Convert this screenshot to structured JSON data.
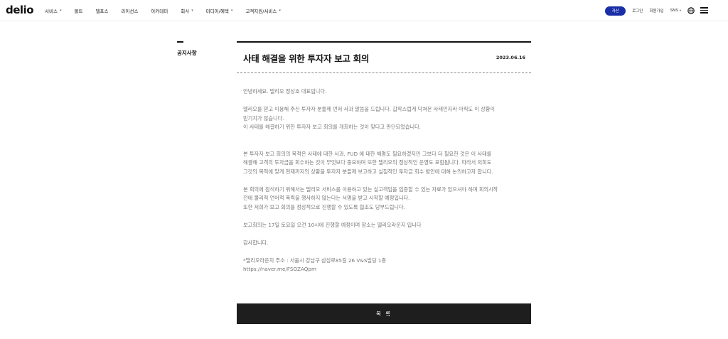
{
  "header": {
    "logo": "delio",
    "nav": [
      {
        "label": "서비스",
        "dropdown": true
      },
      {
        "label": "볼트",
        "dropdown": false
      },
      {
        "label": "델포스",
        "dropdown": false
      },
      {
        "label": "라이선스",
        "dropdown": false
      },
      {
        "label": "아카데미",
        "dropdown": false
      },
      {
        "label": "회사",
        "dropdown": true
      },
      {
        "label": "미디어/혜택",
        "dropdown": true
      },
      {
        "label": "고객지원/서비스",
        "dropdown": true
      }
    ],
    "pill_label": "자산",
    "login": "로그인",
    "signup": "회원가입",
    "sns": "SNS",
    "accent_color": "#1a2ea8"
  },
  "sidebar": {
    "title": "공지사항"
  },
  "article": {
    "title": "사태 해결을 위한 투자자 보고 회의",
    "date": "2023.06.16",
    "paragraphs": [
      "안녕하세요. 델리오 정상호 대표입니다.",
      "델리오를 믿고 이용해 주신 투자자 분들께 먼저 사과 말씀을 드립니다. 갑작스럽게 닥쳐온 사태인지라 아직도 이 상황이\n믿기지가 않습니다.\n이 사태를 해결하기 위한 투자자 보고 회의를 개최하는 것이 맞다고 판단되었습니다.",
      "본 투자자 보고 회의의 목적은 사태에 대한 사과, FUD 에 대한 해명도 필요하겠지만 그보다 더 필요한 것은 이 사태를\n해결해 고객의 투자금을 회수하는 것이 무엇보다 중요하며 또한 델리오의 정상적인 운영도 포함됩니다. 따라서 저희도\n그것의 목적에 맞게 현재까지의 상황을 투자자 분들께 보고하고 실질적인 투자금 회수 방안에 대해 논의하고자 합니다.",
      "본 회의에 참석하기 위해서는 델리오 서비스를 이용하고 있는 실고객임을 입증할 수 있는 자료가 있으셔야 하며 회의시작\n전에 물리적 언어적 폭력을 행사하지 않는다는 서명을 받고 시작할 예정입니다.\n또한 저희가 보고 회의를 정상적으로 진행할 수 있도록 협조도 당부드립니다.",
      "보고회의는 17일 토요일 오전 10시에 진행할 예정이며 장소는 델리오라운지 입니다",
      "감사합니다.",
      "*델리오라운지 주소 : 서울시 강남구 삼성로85길 26 V&S빌딩 1층\nhttps://naver.me/FSOZAQpm"
    ]
  },
  "list_button": "목 록"
}
